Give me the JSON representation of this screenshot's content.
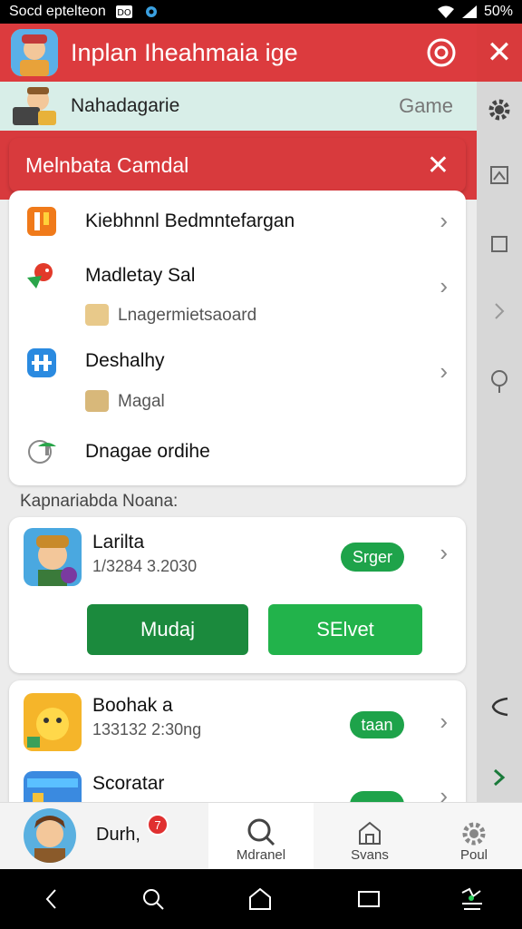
{
  "status_bar": {
    "left_text": "Socd eptelteon",
    "battery": "50%"
  },
  "header": {
    "title": "Inplan Iheahmaia ige"
  },
  "subbar": {
    "name": "Nahadagarie",
    "game_label": "Game"
  },
  "banner": {
    "title": "Melnbata Camdal",
    "close": "✕"
  },
  "menu": [
    {
      "title": "Kiebhnnl Bedmntefargan",
      "subtitle": ""
    },
    {
      "title": "Madletay Sal",
      "subtitle": "Lnagermietsaoard"
    },
    {
      "title": "Deshalhy",
      "subtitle": "Magal"
    },
    {
      "title": "Dnagae ordihe",
      "subtitle": ""
    }
  ],
  "section_label": "Kapnariabda Noana:",
  "featured": {
    "name": "Larilta",
    "meta": "1/3284 3.2030",
    "pill": "Srger",
    "button_primary": "Mudaj",
    "button_secondary": "SElvet"
  },
  "list": [
    {
      "name": "Boohak a",
      "meta": "133132 2:30ng",
      "pill": "taan"
    },
    {
      "name": "Scoratar",
      "meta": "",
      "pill": ""
    }
  ],
  "bottom_nav": {
    "profile_name": "Durh,",
    "badge": "7",
    "tabs": [
      "Mdranel",
      "Svans",
      "Poul"
    ]
  },
  "colors": {
    "accent_red": "#dc3b3e",
    "green": "#1ea34a",
    "mint": "#d8eee8"
  }
}
